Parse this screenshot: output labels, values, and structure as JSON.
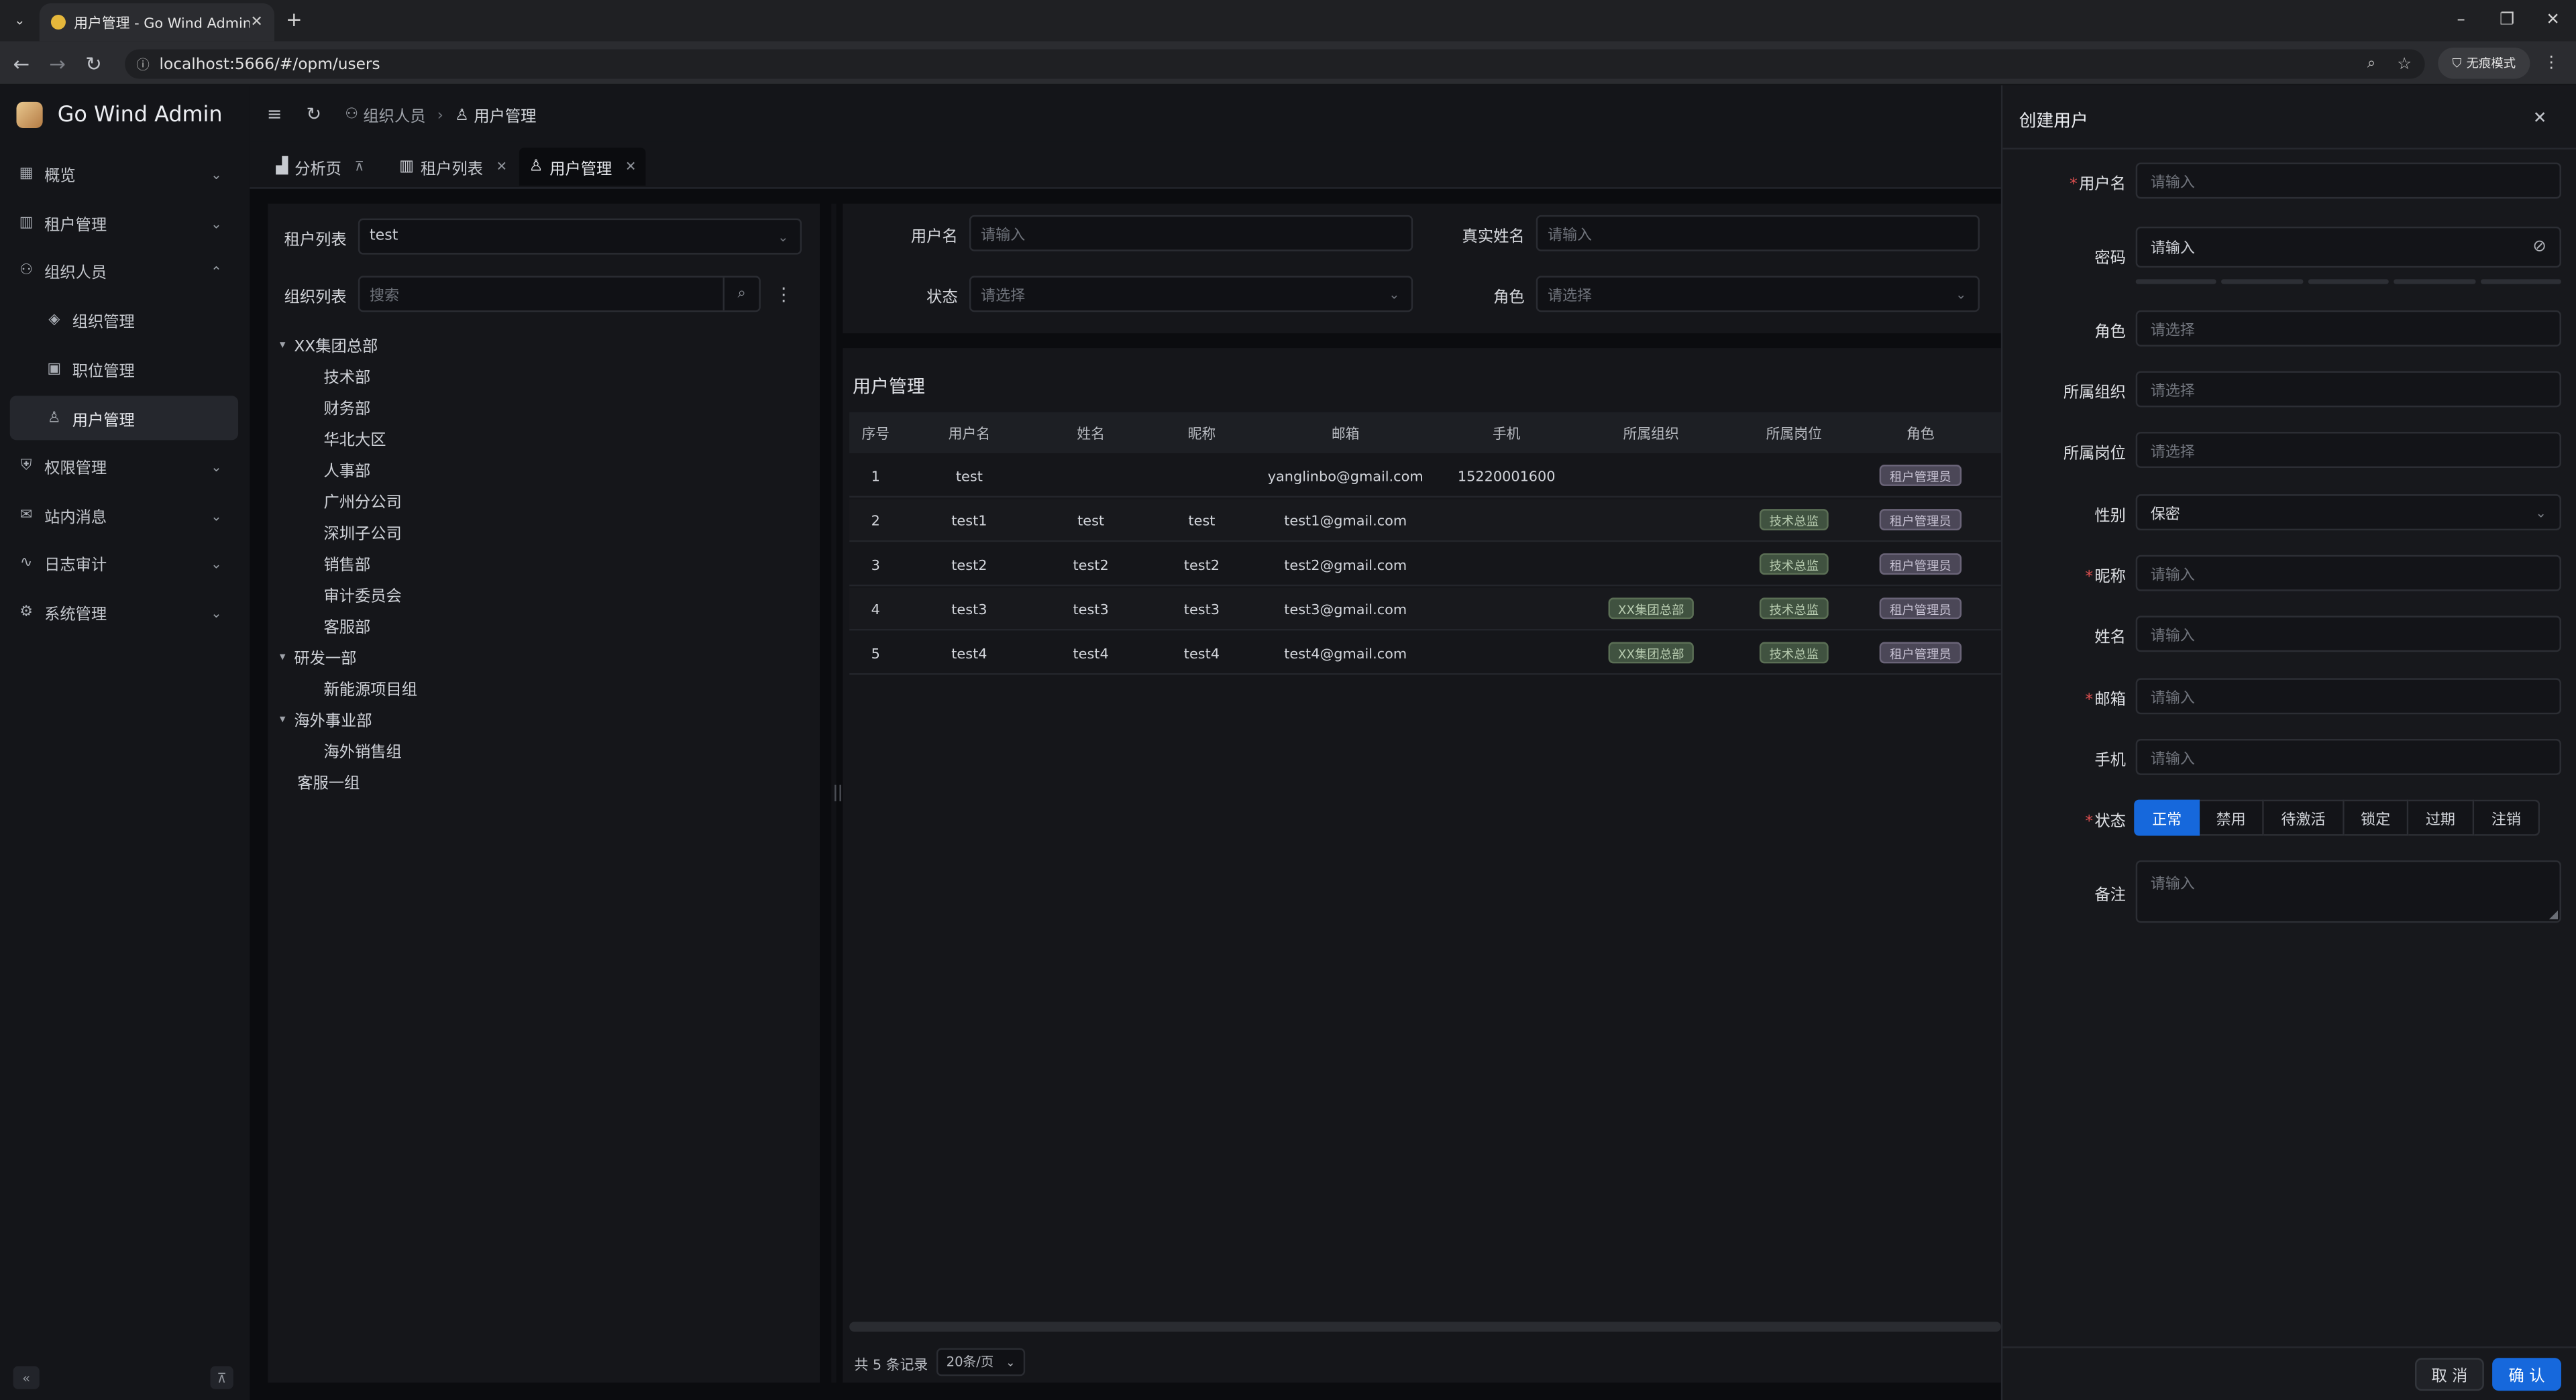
{
  "browser": {
    "tab_title": "用户管理 - Go Wind Admin",
    "url": "localhost:5666/#/opm/users",
    "incognito_label": "无痕模式"
  },
  "app": {
    "name": "Go Wind Admin"
  },
  "sidebar": {
    "items": [
      {
        "label": "概览",
        "icon": "grid-icon"
      },
      {
        "label": "租户管理",
        "icon": "building-icon"
      },
      {
        "label": "组织人员",
        "icon": "users-icon"
      },
      {
        "label": "组织管理",
        "icon": "layers-icon"
      },
      {
        "label": "职位管理",
        "icon": "briefcase-icon"
      },
      {
        "label": "用户管理",
        "icon": "user-icon"
      },
      {
        "label": "权限管理",
        "icon": "shield-icon"
      },
      {
        "label": "站内消息",
        "icon": "mail-icon"
      },
      {
        "label": "日志审计",
        "icon": "pulse-icon"
      },
      {
        "label": "系统管理",
        "icon": "gear-icon"
      }
    ]
  },
  "header": {
    "breadcrumb": [
      "组织人员",
      "用户管理"
    ]
  },
  "page_tabs": [
    "分析页",
    "租户列表",
    "用户管理"
  ],
  "left_panel": {
    "tenant_label": "租户列表",
    "tenant_value": "test",
    "org_label": "组织列表",
    "search_placeholder": "搜索",
    "tree": [
      {
        "label": "XX集团总部",
        "level": 0,
        "expanded": true
      },
      {
        "label": "技术部",
        "level": 1
      },
      {
        "label": "财务部",
        "level": 1
      },
      {
        "label": "华北大区",
        "level": 1
      },
      {
        "label": "人事部",
        "level": 1
      },
      {
        "label": "广州分公司",
        "level": 1
      },
      {
        "label": "深圳子公司",
        "level": 1
      },
      {
        "label": "销售部",
        "level": 1
      },
      {
        "label": "审计委员会",
        "level": 1
      },
      {
        "label": "客服部",
        "level": 1
      },
      {
        "label": "研发一部",
        "level": 0,
        "expanded": true
      },
      {
        "label": "新能源项目组",
        "level": 1
      },
      {
        "label": "海外事业部",
        "level": 0,
        "expanded": true
      },
      {
        "label": "海外销售组",
        "level": 1
      },
      {
        "label": "客服一组",
        "level": 0
      }
    ]
  },
  "filters": {
    "username_label": "用户名",
    "username_placeholder": "请输入",
    "realname_label": "真实姓名",
    "realname_placeholder": "请输入",
    "status_label": "状态",
    "status_placeholder": "请选择",
    "role_label": "角色",
    "role_placeholder": "请选择"
  },
  "table": {
    "title": "用户管理",
    "columns": [
      "序号",
      "用户名",
      "姓名",
      "昵称",
      "邮箱",
      "手机",
      "所属组织",
      "所属岗位",
      "角色"
    ],
    "rows": [
      {
        "no": "1",
        "username": "test",
        "name": "",
        "nick": "",
        "email": "yanglinbo@gmail.com",
        "phone": "15220001600",
        "org": "",
        "post": "",
        "role": "租户管理员"
      },
      {
        "no": "2",
        "username": "test1",
        "name": "test",
        "nick": "test",
        "email": "test1@gmail.com",
        "phone": "",
        "org": "",
        "post": "技术总监",
        "role": "租户管理员"
      },
      {
        "no": "3",
        "username": "test2",
        "name": "test2",
        "nick": "test2",
        "email": "test2@gmail.com",
        "phone": "",
        "org": "",
        "post": "技术总监",
        "role": "租户管理员"
      },
      {
        "no": "4",
        "username": "test3",
        "name": "test3",
        "nick": "test3",
        "email": "test3@gmail.com",
        "phone": "",
        "org": "XX集团总部",
        "post": "技术总监",
        "role": "租户管理员"
      },
      {
        "no": "5",
        "username": "test4",
        "name": "test4",
        "nick": "test4",
        "email": "test4@gmail.com",
        "phone": "",
        "org": "XX集团总部",
        "post": "技术总监",
        "role": "租户管理员"
      }
    ],
    "total_text": "共 5 条记录",
    "page_size": "20条/页"
  },
  "drawer": {
    "title": "创建用户",
    "fields": {
      "username": {
        "label": "用户名",
        "placeholder": "请输入"
      },
      "password": {
        "label": "密码",
        "placeholder": "请输入"
      },
      "role": {
        "label": "角色",
        "placeholder": "请选择"
      },
      "org": {
        "label": "所属组织",
        "placeholder": "请选择"
      },
      "post": {
        "label": "所属岗位",
        "placeholder": "请选择"
      },
      "gender": {
        "label": "性别",
        "value": "保密"
      },
      "nickname": {
        "label": "昵称",
        "placeholder": "请输入"
      },
      "realname": {
        "label": "姓名",
        "placeholder": "请输入"
      },
      "email": {
        "label": "邮箱",
        "placeholder": "请输入"
      },
      "mobile": {
        "label": "手机",
        "placeholder": "请输入"
      },
      "status": {
        "label": "状态",
        "options": [
          "正常",
          "禁用",
          "待激活",
          "锁定",
          "过期",
          "注销"
        ],
        "selected": "正常"
      },
      "remark": {
        "label": "备注",
        "placeholder": "请输入"
      }
    },
    "cancel_label": "取 消",
    "confirm_label": "确 认"
  },
  "colors": {
    "primary": "#1668dc",
    "bg": "#0b0c0f",
    "panel": "#15161a"
  }
}
